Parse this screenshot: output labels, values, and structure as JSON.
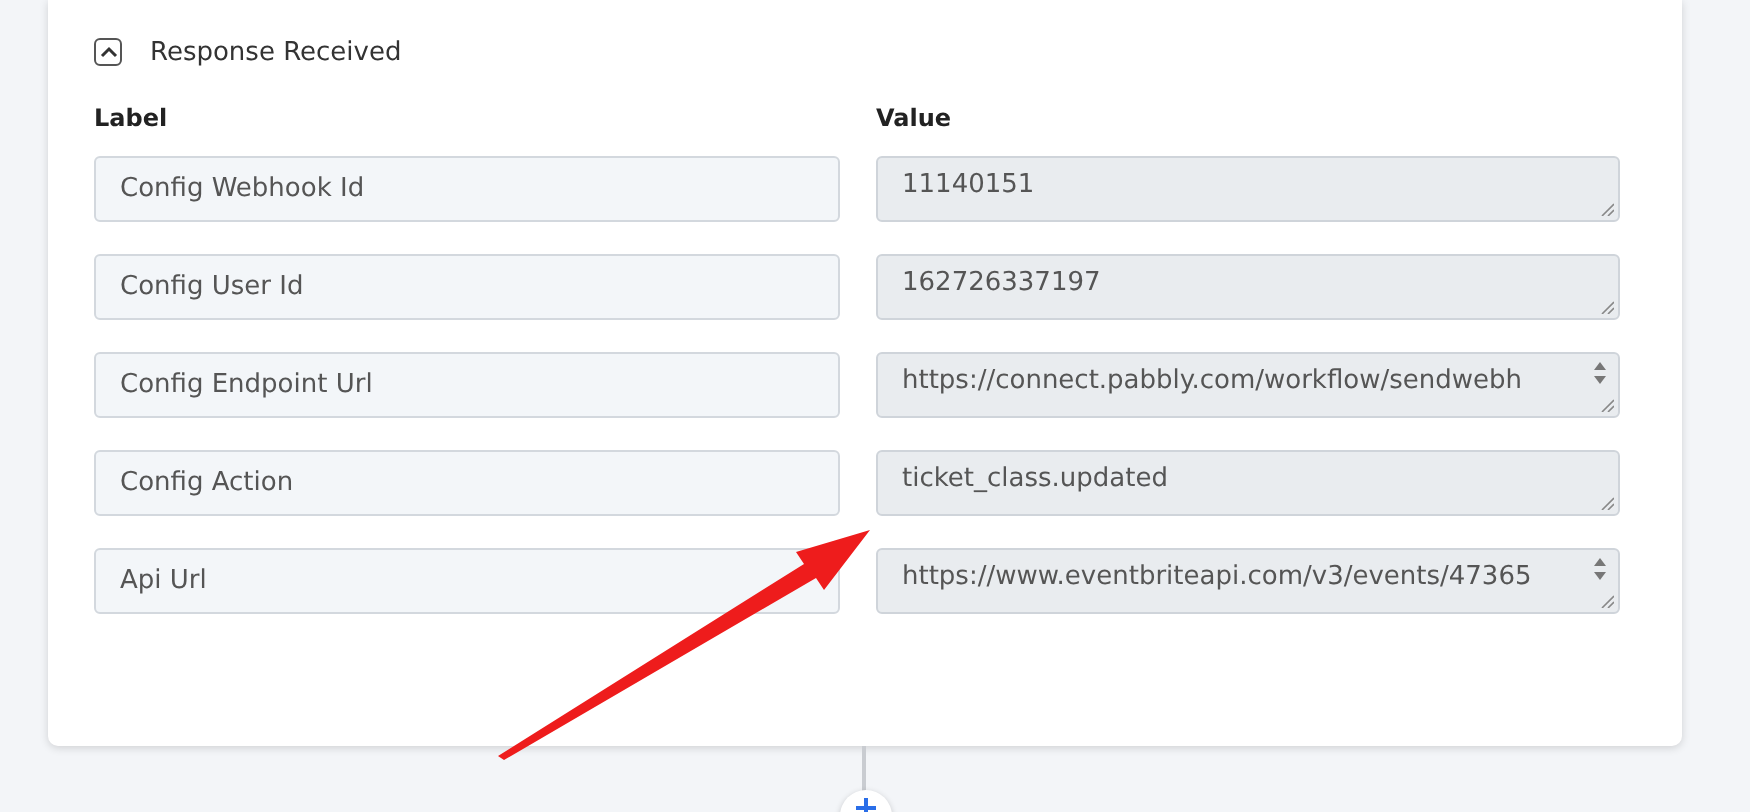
{
  "section": {
    "title": "Response Received",
    "expanded": true
  },
  "columns": [
    "Label",
    "Value"
  ],
  "rows": [
    {
      "label": "Config Webhook Id",
      "value": "11140151",
      "kind": "plain"
    },
    {
      "label": "Config User Id",
      "value": "162726337197",
      "kind": "plain"
    },
    {
      "label": "Config Endpoint Url",
      "value": "https://connect.pabbly.com/workflow/sendwebh",
      "kind": "scroll"
    },
    {
      "label": "Config Action",
      "value": "ticket_class.updated",
      "kind": "plain"
    },
    {
      "label": "Api Url",
      "value": "https://www.eventbriteapi.com/v3/events/47365",
      "kind": "scroll"
    }
  ]
}
